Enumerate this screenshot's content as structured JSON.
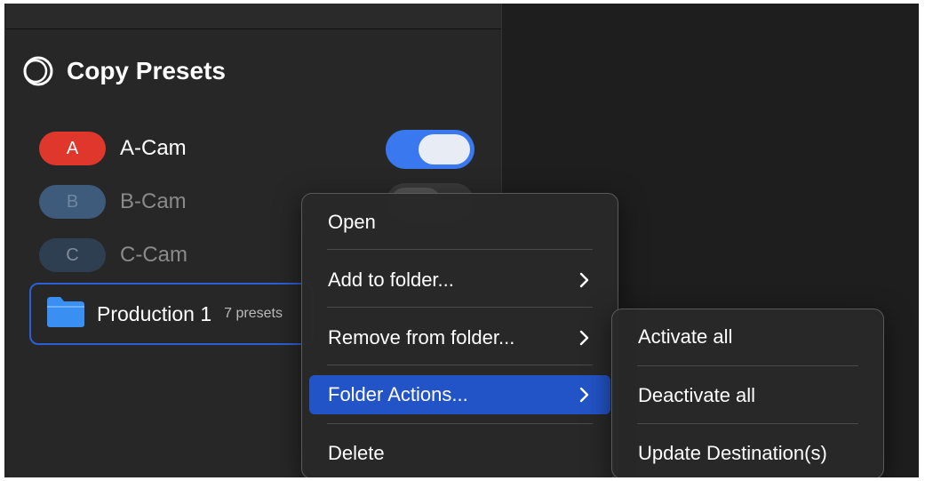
{
  "panel": {
    "title": "Copy Presets"
  },
  "cams": [
    {
      "letter": "A",
      "label": "A-Cam",
      "color": "#e0372c",
      "active": true
    },
    {
      "letter": "B",
      "label": "B-Cam",
      "color": "#3e5b7c",
      "active": false
    },
    {
      "letter": "C",
      "label": "C-Cam",
      "color": "#2f3f52",
      "active": false
    }
  ],
  "toggle_color": "#3a78f0",
  "folder": {
    "name": "Production 1",
    "count": "7 presets"
  },
  "context_menu": {
    "items": [
      {
        "label": "Open",
        "has_submenu": false
      },
      {
        "label": "Add to folder...",
        "has_submenu": true
      },
      {
        "label": "Remove from folder...",
        "has_submenu": true
      },
      {
        "label": "Folder Actions...",
        "has_submenu": true,
        "highlighted": true
      },
      {
        "label": "Delete",
        "has_submenu": false
      }
    ]
  },
  "submenu": {
    "items": [
      {
        "label": "Activate all"
      },
      {
        "label": "Deactivate all"
      },
      {
        "label": "Update Destination(s)"
      }
    ]
  },
  "icons": {
    "title": "circle-stack-icon",
    "folder": "folder-icon",
    "chevron": "chevron-right-icon"
  }
}
